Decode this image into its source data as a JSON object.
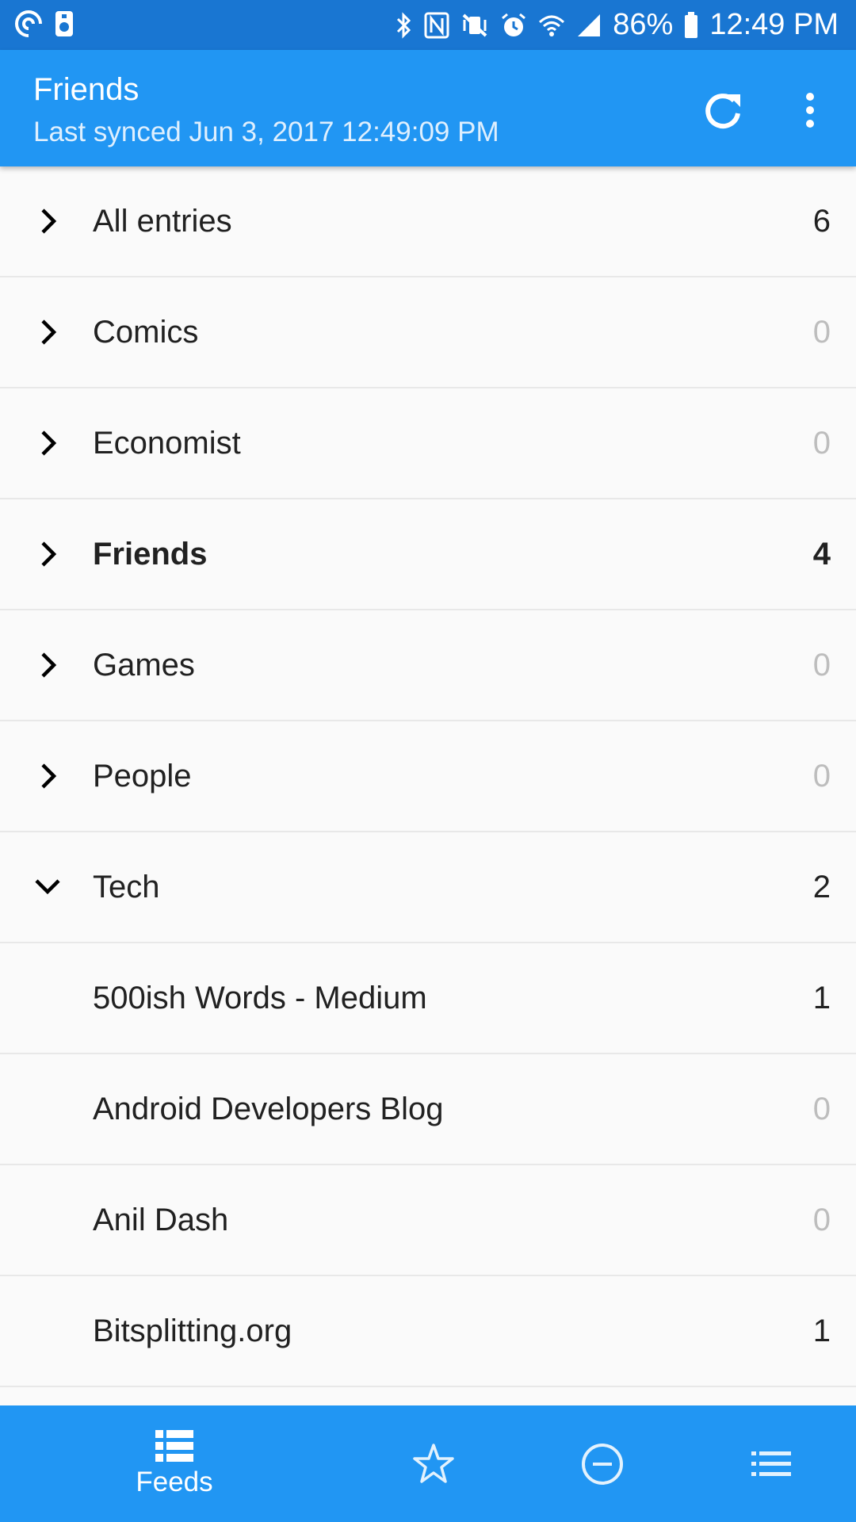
{
  "status_bar": {
    "battery": "86%",
    "time": "12:49 PM"
  },
  "app_bar": {
    "title": "Friends",
    "subtitle": "Last synced Jun 3, 2017 12:49:09 PM"
  },
  "feeds": [
    {
      "label": "All entries",
      "count": "6",
      "expandable": true,
      "expanded": false
    },
    {
      "label": "Comics",
      "count": "0",
      "expandable": true,
      "expanded": false
    },
    {
      "label": "Economist",
      "count": "0",
      "expandable": true,
      "expanded": false
    },
    {
      "label": "Friends",
      "count": "4",
      "expandable": true,
      "expanded": false,
      "selected": true
    },
    {
      "label": "Games",
      "count": "0",
      "expandable": true,
      "expanded": false
    },
    {
      "label": "People",
      "count": "0",
      "expandable": true,
      "expanded": false
    },
    {
      "label": "Tech",
      "count": "2",
      "expandable": true,
      "expanded": true
    },
    {
      "label": "500ish Words - Medium",
      "count": "1",
      "expandable": false
    },
    {
      "label": "Android Developers Blog",
      "count": "0",
      "expandable": false
    },
    {
      "label": "Anil Dash",
      "count": "0",
      "expandable": false
    },
    {
      "label": "Bitsplitting.org",
      "count": "1",
      "expandable": false
    }
  ],
  "bottom_nav": {
    "feeds_label": "Feeds"
  },
  "colors": {
    "status_bar": "#1976d2",
    "primary": "#2196f3",
    "zero_count": "#bdbdbd"
  },
  "icons": [
    "refresh-icon",
    "more-vert-icon",
    "chevron-right-icon",
    "chevron-down-icon",
    "feeds-icon",
    "star-icon",
    "minus-circle-icon",
    "list-icon"
  ]
}
